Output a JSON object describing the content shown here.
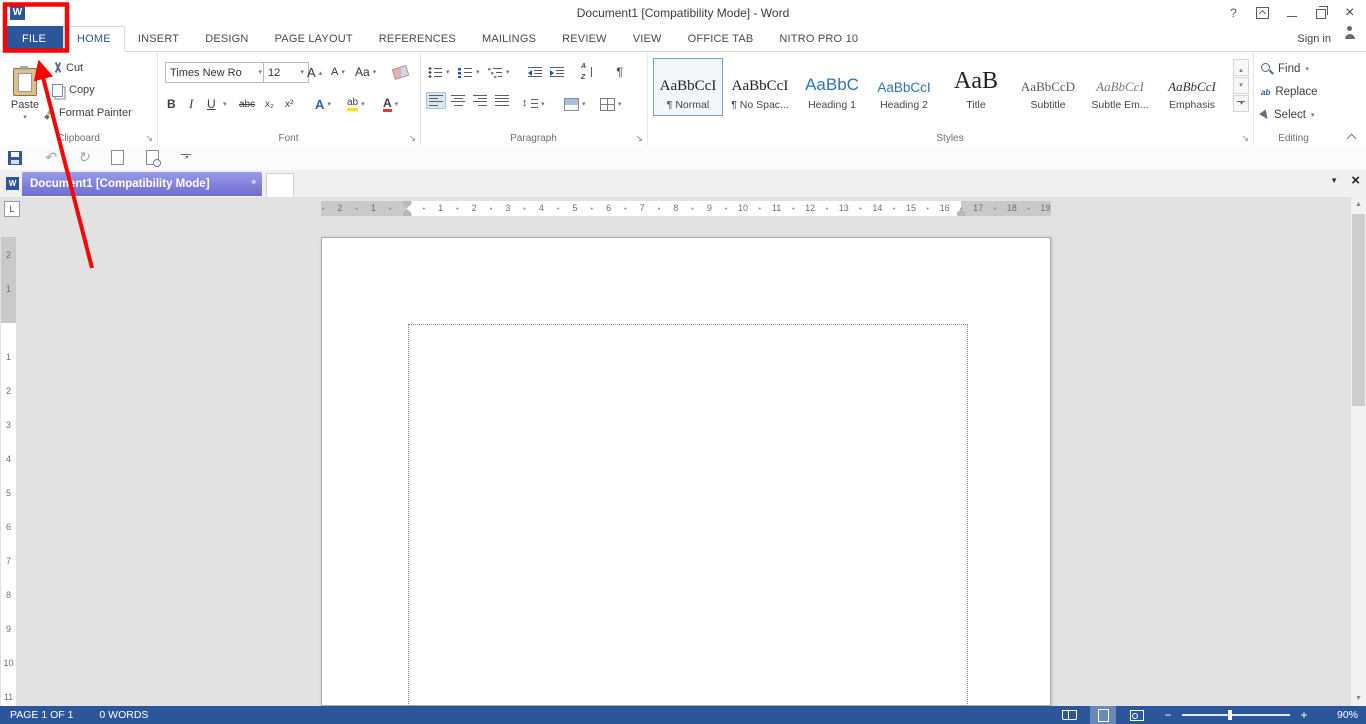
{
  "titlebar": {
    "title": "Document1 [Compatibility Mode] - Word",
    "help": "?",
    "sign_in": "Sign in"
  },
  "ribbon_tabs": {
    "file": "FILE",
    "home": "HOME",
    "insert": "INSERT",
    "design": "DESIGN",
    "page_layout": "PAGE LAYOUT",
    "references": "REFERENCES",
    "mailings": "MAILINGS",
    "review": "REVIEW",
    "view": "VIEW",
    "office_tab": "OFFICE TAB",
    "nitro": "NITRO PRO 10"
  },
  "clipboard": {
    "label": "Clipboard",
    "paste": "Paste",
    "cut": "Cut",
    "copy": "Copy",
    "format_painter": "Format Painter"
  },
  "font": {
    "label": "Font",
    "name": "Times New Ro",
    "size": "12",
    "grow": "A",
    "shrink": "A",
    "change_case": "Aa",
    "bold": "B",
    "italic": "I",
    "underline": "U",
    "strike": "abc",
    "subscript": "x₂",
    "superscript": "x²",
    "effects": "A",
    "highlight": "ab",
    "color": "A"
  },
  "paragraph": {
    "label": "Paragraph"
  },
  "styles": {
    "label": "Styles",
    "items": [
      {
        "sample": "AaBbCcI",
        "name": "¶ Normal"
      },
      {
        "sample": "AaBbCcI",
        "name": "¶ No Spac..."
      },
      {
        "sample": "AaBbC",
        "name": "Heading 1"
      },
      {
        "sample": "AaBbCcI",
        "name": "Heading 2"
      },
      {
        "sample": "AaB",
        "name": "Title"
      },
      {
        "sample": "AaBbCcD",
        "name": "Subtitle"
      },
      {
        "sample": "AaBbCcI",
        "name": "Subtle Em..."
      },
      {
        "sample": "AaBbCcI",
        "name": "Emphasis"
      }
    ]
  },
  "editing": {
    "label": "Editing",
    "find": "Find",
    "replace": "Replace",
    "select": "Select"
  },
  "doc_tabs": {
    "active_tab": "Document1  [Compatibility Mode]"
  },
  "ruler": {
    "tab_selector": "L",
    "h_left": [
      "2",
      "1"
    ],
    "h_mid": [
      "1",
      "2",
      "3",
      "4",
      "5",
      "6",
      "7",
      "8",
      "9",
      "10",
      "11",
      "12",
      "13",
      "14",
      "15",
      "16"
    ],
    "h_right": [
      "17",
      "18",
      "19"
    ],
    "v_upper": [
      "2",
      "1"
    ],
    "v_lower": [
      "1",
      "2",
      "3",
      "4",
      "5",
      "6",
      "7",
      "8",
      "9",
      "10",
      "11"
    ]
  },
  "status": {
    "page": "PAGE 1 OF 1",
    "words": "0 WORDS",
    "zoom_out": "−",
    "zoom_in": "+",
    "zoom": "90%"
  },
  "colors": {
    "accent": "#2b579a",
    "annotation_red": "#f40606",
    "doc_tab_highlight": "#7d7dd8",
    "heading_blue": "#2e74b5"
  }
}
